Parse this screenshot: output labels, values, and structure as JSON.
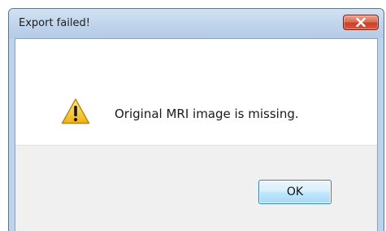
{
  "window": {
    "title": "Export failed!",
    "close_icon": "close-icon"
  },
  "dialog": {
    "icon": "warning-icon",
    "message": "Original MRI image is missing.",
    "ok_label": "OK"
  },
  "colors": {
    "titlebar": "#c2d6ec",
    "close_button": "#c9412a",
    "warning_yellow": "#f6c21c",
    "ok_border": "#3c7fb1"
  }
}
